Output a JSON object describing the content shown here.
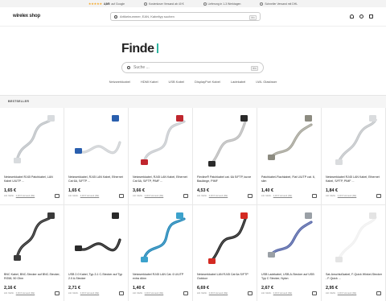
{
  "topbar": {
    "stars": "★★★★★",
    "rating": "4,9/5",
    "rating_suffix": "auf Google",
    "items": [
      "Kostenloser Versand ab 40 €",
      "Lieferung in 1-3 Werktagen",
      "Schneller Versand mit DHL"
    ]
  },
  "header": {
    "logo": "wirelex shop",
    "search_placeholder": "Artikelnummer, EAN, Kabeltyp suchen",
    "search_shortcut": "⌘K"
  },
  "hero": {
    "title": "Finde",
    "search_placeholder": "Suche ...",
    "search_shortcut": "⌘K"
  },
  "chips": [
    "Netzwerkkabel",
    "HDMI Kabel",
    "USB Kabel",
    "DisplayPort Kabel",
    "Ladekabel",
    "LWL Glasfaser"
  ],
  "section": {
    "label": "BESTSELLER"
  },
  "meta": {
    "prefix": "inkl. MwSt.",
    "shipping": "0,00 € Versand (DE)"
  },
  "products": [
    {
      "name": "Netzwerkkabel RJ45 Patchkabel, LAN Kabel U/UTP ...",
      "price": "1,65 €",
      "icon": "grey-rj45-cable-icon",
      "color": "#bfc3c7",
      "plug": "#d8dbde"
    },
    {
      "name": "Netzwerkkabel, RJ45 LAN Kabel, Ethernet Cat 6A, S/FTP ...",
      "price": "1,65 €",
      "icon": "blue-rj45-cable-icon",
      "color": "#cfd2d5",
      "plug": "#2a5fae"
    },
    {
      "name": "Netzwerkkabel, RJ45 LAN Kabel, Ethernet Cat 6A, S/FTP, PIMF ...",
      "price": "3,66 €",
      "icon": "red-blue-rj45-cable-icon",
      "color": "#c9ccd0",
      "plug": "#c0262e"
    },
    {
      "name": "Flexline® Patchkabel cat. 6A S/FTP, kurze Baulänge, PIMF",
      "price": "4,53 €",
      "icon": "black-pink-rj45-cable-icon",
      "color": "#bdbdbd",
      "plug": "#2a2a2a"
    },
    {
      "name": "Patchkabel-Flachkabel, Flat U/UTP cat. 6, slim",
      "price": "1,40 €",
      "icon": "flat-cable-icon",
      "color": "#a6a59a",
      "plug": "#8c8b80"
    },
    {
      "name": "Netzwerkkabel RJ45 LAN Kabel, Ethernet Kabel, S/FTP, PIMF ...",
      "price": "1,84 €",
      "icon": "grey-rj45-cable-icon",
      "color": "#c3c6c9",
      "plug": "#dadcde"
    },
    {
      "name": "BNC Kabel, BNC-Stecker auf BNC-Stecker, RG58, 50 Ohm",
      "price": "2,16 €",
      "icon": "bnc-cable-icon",
      "color": "#2a2a2a",
      "plug": "#3a3a3a"
    },
    {
      "name": "USB 2.0 Kabel, Typ-3.1 C-Stecker auf Typ 2.0 A-Stecker",
      "price": "2,71 €",
      "icon": "usb-c-cable-icon",
      "color": "#1e1e1e",
      "plug": "#2a2a2a"
    },
    {
      "name": "Netzwerkkabel RJ45 LAN Cat. 6 U/UTP extra dünn",
      "price": "1,40 €",
      "icon": "cyan-rj45-cable-icon",
      "color": "#1f86b8",
      "plug": "#3ca2cc"
    },
    {
      "name": "Netzwerkkabel LAN RJ45 Cat 6a S/FTP Outdoor",
      "price": "6,69 €",
      "icon": "red-outdoor-cable-icon",
      "color": "#222222",
      "plug": "#d42a22"
    },
    {
      "name": "USB Ladekabel, USB-A-Stecker auf USB Typ C Stecker, Nylon",
      "price": "2,67 €",
      "icon": "usb-nylon-cable-icon",
      "color": "#5566a8",
      "plug": "#9aa0a6"
    },
    {
      "name": "Sat-Anschlußkabel, F-Quick Winkel-Stecker - F-Quick ...",
      "price": "2,95 €",
      "icon": "sat-cable-icon",
      "color": "#f1f1f1",
      "plug": "#e4e4e4"
    }
  ]
}
